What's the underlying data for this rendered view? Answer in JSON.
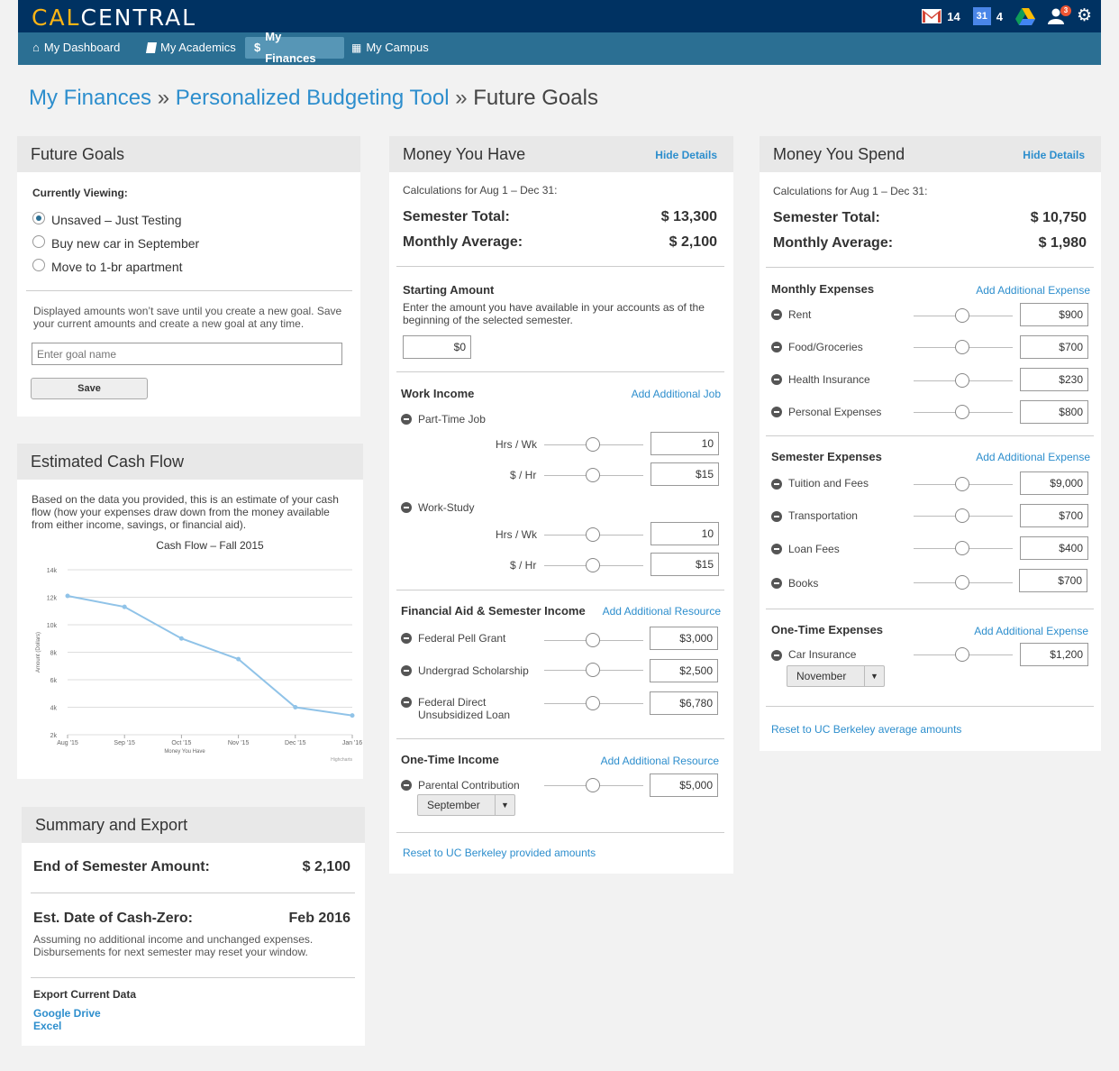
{
  "app": {
    "logo_a": "CAL",
    "logo_b": "CENTRAL"
  },
  "top_icons": {
    "mail_count": "14",
    "calendar_day": "31",
    "calendar_count": "4",
    "notification_count": "3"
  },
  "nav": [
    {
      "label": "My Dashboard",
      "icon": "home-icon"
    },
    {
      "label": "My Academics",
      "icon": "book-icon"
    },
    {
      "label": "My Finances",
      "icon": "dollar-icon",
      "active": true
    },
    {
      "label": "My Campus",
      "icon": "grid-icon"
    }
  ],
  "breadcrumb": {
    "a": "My Finances",
    "sep1": "»",
    "b": "Personalized Budgeting Tool",
    "sep2": "»",
    "current": "Future Goals"
  },
  "future_goals": {
    "title": "Future Goals",
    "viewing_label": "Currently Viewing:",
    "options": [
      "Unsaved – Just Testing",
      "Buy new car in September",
      "Move to 1-br apartment"
    ],
    "note": "Displayed amounts won’t save until you create a new goal. Save your current amounts and create a new goal at any time.",
    "input_placeholder": "Enter goal name",
    "save_label": "Save"
  },
  "cash_flow": {
    "title": "Estimated Cash Flow",
    "desc": "Based on the data you provided, this is an estimate of your cash flow (how your expenses draw down from the money available from either income, savings, or financial aid).",
    "credit": "Highcharts"
  },
  "chart_data": {
    "type": "line",
    "title": "Cash Flow – Fall 2015",
    "xlabel": "Money You Have",
    "ylabel": "Amount (Dollars)",
    "categories": [
      "Aug '15",
      "Sep '15",
      "Oct '15",
      "Nov '15",
      "Dec '15",
      "Jan '16"
    ],
    "x": [
      0,
      1,
      2,
      3,
      4,
      5
    ],
    "values": [
      12100,
      11300,
      9000,
      7500,
      4000,
      3400
    ],
    "y_ticks": [
      "2k",
      "4k",
      "6k",
      "8k",
      "10k",
      "12k",
      "14k"
    ],
    "ylim": [
      2000,
      14000
    ],
    "grid": true,
    "color": "#90c3e8"
  },
  "summary": {
    "title": "Summary and Export",
    "end_label": "End of Semester Amount:",
    "end_value": "$ 2,100",
    "zero_label": "Est. Date of Cash-Zero:",
    "zero_value": "Feb 2016",
    "zero_note": "Assuming no additional income and unchanged expenses. Disbursements for next semester may reset your window.",
    "export_label": "Export Current Data",
    "export_links": [
      "Google Drive",
      "Excel"
    ]
  },
  "have": {
    "title": "Money You Have",
    "hide": "Hide Details",
    "calc": "Calculations for Aug 1 – Dec 31:",
    "sem_label": "Semester Total:",
    "sem_value": "$ 13,300",
    "mon_label": "Monthly Average:",
    "mon_value": "$ 2,100",
    "start_title": "Starting Amount",
    "start_desc": "Enter the amount you have available in your accounts as of the beginning of the selected semester.",
    "start_value": "$0",
    "work_title": "Work Income",
    "work_add": "Add Additional Job",
    "part_time": "Part-Time Job",
    "hrs_label": "Hrs / Wk",
    "rate_label": "$ / Hr",
    "pt_hrs": "10",
    "pt_rate": "$15",
    "work_study": "Work-Study",
    "ws_hrs": "10",
    "ws_rate": "$15",
    "aid_title": "Financial Aid & Semester Income",
    "aid_add": "Add Additional Resource",
    "aid": [
      {
        "label": "Federal Pell Grant",
        "value": "$3,000"
      },
      {
        "label": "Undergrad Scholarship",
        "value": "$2,500"
      },
      {
        "label": "Federal Direct Unsubsidized Loan",
        "value": "$6,780"
      }
    ],
    "onetime_title": "One-Time Income",
    "onetime_add": "Add Additional Resource",
    "parent_label": "Parental Contribution",
    "parent_value": "$5,000",
    "parent_month": "September",
    "reset": "Reset to UC Berkeley provided amounts"
  },
  "spend": {
    "title": "Money You Spend",
    "hide": "Hide Details",
    "calc": "Calculations for Aug 1 – Dec 31:",
    "sem_label": "Semester Total:",
    "sem_value": "$ 10,750",
    "mon_label": "Monthly Average:",
    "mon_value": "$ 1,980",
    "monthly_title": "Monthly Expenses",
    "add": "Add Additional Expense",
    "monthly": [
      {
        "label": "Rent",
        "value": "$900"
      },
      {
        "label": "Food/Groceries",
        "value": "$700"
      },
      {
        "label": "Health Insurance",
        "value": "$230"
      },
      {
        "label": "Personal Expenses",
        "value": "$800"
      }
    ],
    "semester_title": "Semester Expenses",
    "semester": [
      {
        "label": "Tuition and Fees",
        "value": "$9,000"
      },
      {
        "label": "Transportation",
        "value": "$700"
      },
      {
        "label": "Loan Fees",
        "value": "$400"
      },
      {
        "label": "Books",
        "value": "$700"
      }
    ],
    "onetime_title": "One-Time Expenses",
    "car_label": "Car Insurance",
    "car_value": "$1,200",
    "car_month": "November",
    "reset": "Reset to UC Berkeley average amounts"
  }
}
